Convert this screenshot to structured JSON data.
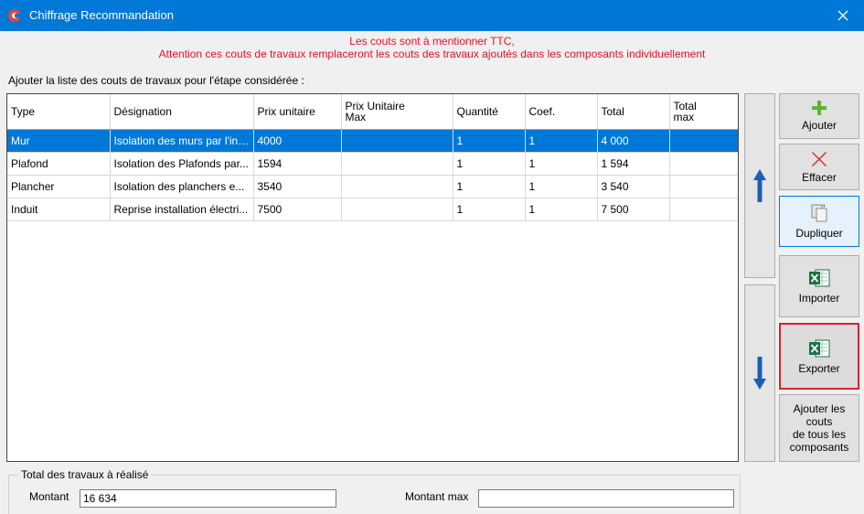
{
  "window": {
    "title": "Chiffrage Recommandation"
  },
  "warning": {
    "line1": "Les couts sont à mentionner TTC,",
    "line2": "Attention ces couts de travaux remplaceront les couts des travaux ajoutés dans les composants individuellement"
  },
  "intro_label": "Ajouter la liste des couts de travaux pour l'étape considérée :",
  "table": {
    "columns": [
      {
        "line1": "Type",
        "line2": ""
      },
      {
        "line1": "Désignation",
        "line2": ""
      },
      {
        "line1": "Prix unitaire",
        "line2": ""
      },
      {
        "line1": "Prix Unitaire",
        "line2": "Max"
      },
      {
        "line1": "Quantité",
        "line2": ""
      },
      {
        "line1": "Coef.",
        "line2": ""
      },
      {
        "line1": "Total",
        "line2": ""
      },
      {
        "line1": "Total",
        "line2": "max"
      }
    ],
    "rows": [
      {
        "type": "Mur",
        "designation": "Isolation des murs par l'int...",
        "prix_unitaire": "4000",
        "prix_max": "",
        "quantite": "1",
        "coef": "1",
        "total": "4 000",
        "total_max": ""
      },
      {
        "type": "Plafond",
        "designation": "Isolation des Plafonds par...",
        "prix_unitaire": "1594",
        "prix_max": "",
        "quantite": "1",
        "coef": "1",
        "total": "1 594",
        "total_max": ""
      },
      {
        "type": "Plancher",
        "designation": "Isolation des planchers e...",
        "prix_unitaire": "3540",
        "prix_max": "",
        "quantite": "1",
        "coef": "1",
        "total": "3 540",
        "total_max": ""
      },
      {
        "type": "Induit",
        "designation": "Reprise installation électri...",
        "prix_unitaire": "7500",
        "prix_max": "",
        "quantite": "1",
        "coef": "1",
        "total": "7 500",
        "total_max": ""
      }
    ]
  },
  "buttons": {
    "ajouter": "Ajouter",
    "effacer": "Effacer",
    "dupliquer": "Dupliquer",
    "importer": "Importer",
    "exporter": "Exporter",
    "ajouter_couts_line1": "Ajouter les",
    "ajouter_couts_line2": "couts",
    "ajouter_couts_line3": "de tous les",
    "ajouter_couts_line4": "composants"
  },
  "totals": {
    "group_label": "Total des travaux à réalisé",
    "montant_label": "Montant",
    "montant_value": "16 634",
    "montant_max_label": "Montant max",
    "montant_max_value": ""
  },
  "icons": {
    "app": "app-logo-icon",
    "close": "close-icon",
    "up": "arrow-up-icon",
    "down": "arrow-down-icon",
    "ajouter": "plus-icon",
    "effacer": "x-icon",
    "dupliquer": "duplicate-icon",
    "importer": "excel-icon",
    "exporter": "excel-icon"
  },
  "colors": {
    "titlebar": "#0078d7",
    "warning": "#e81123",
    "selection": "#0078d7",
    "export_highlight": "#d9232d",
    "arrow": "#1a5fb4",
    "plus": "#5cb531",
    "x": "#d12d2d",
    "excel": "#1e7145"
  }
}
